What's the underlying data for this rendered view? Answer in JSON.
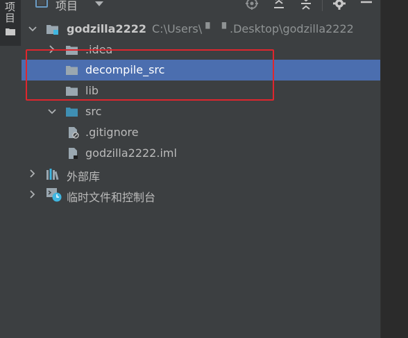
{
  "sidebar": {
    "tab_label": "项目",
    "folder_icon": "folder-icon"
  },
  "toolbar": {
    "title": "项目",
    "view_icon": "project-view-icon",
    "dropdown_icon": "chevron-down-icon",
    "buttons": [
      {
        "name": "locate-icon"
      },
      {
        "name": "expand-all-icon"
      },
      {
        "name": "collapse-all-icon"
      },
      {
        "name": "gear-icon"
      },
      {
        "name": "hide-icon"
      }
    ]
  },
  "tree": {
    "root": {
      "name": "godzilla2222",
      "path": "C:\\Users\\ ▘ ▝ .Desktop\\godzilla2222",
      "expanded": true
    },
    "items": [
      {
        "label": ".idea",
        "type": "folder",
        "collapsed": true
      },
      {
        "label": "decompile_src",
        "type": "folder",
        "selected": true
      },
      {
        "label": "lib",
        "type": "folder"
      },
      {
        "label": "src",
        "type": "source-folder",
        "expanded": true
      },
      {
        "label": ".gitignore",
        "type": "ignored-file"
      },
      {
        "label": "godzilla2222.iml",
        "type": "module-file"
      },
      {
        "label": "外部库",
        "type": "external-libraries",
        "collapsed": true
      },
      {
        "label": "临时文件和控制台",
        "type": "scratches",
        "collapsed": true
      }
    ]
  },
  "colors": {
    "selection": "#4b6eaf",
    "annotation": "#e0262d",
    "source_folder": "#3f8fb3",
    "folder": "#9aa7b0"
  }
}
